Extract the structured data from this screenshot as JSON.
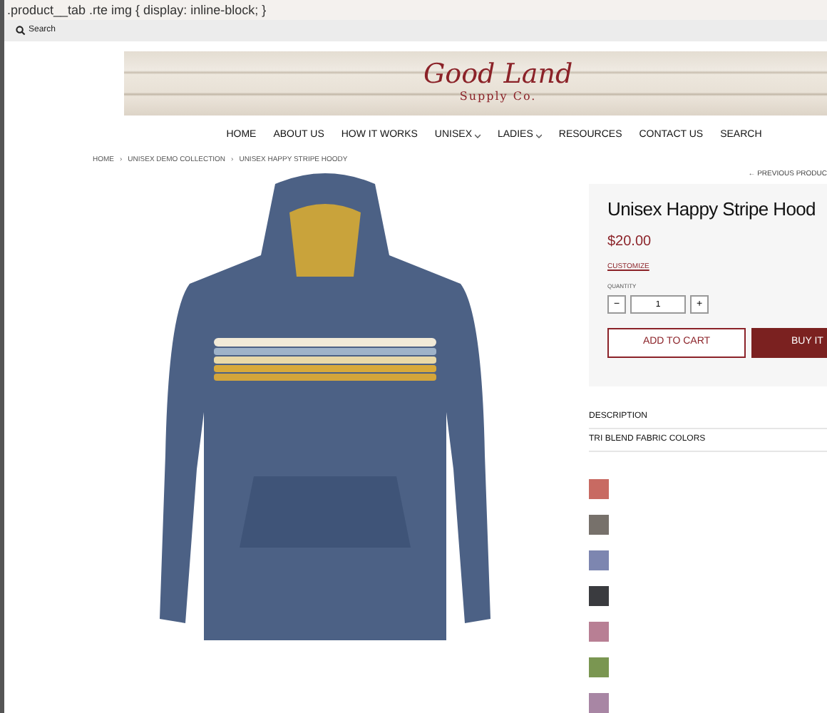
{
  "code_bar": {
    "text": ".product__tab .rte img { display: inline-block; }"
  },
  "search_bar": {
    "label": "Search"
  },
  "logo": {
    "title": "Good Land",
    "subtitle": "Supply Co."
  },
  "nav": [
    {
      "label": "HOME",
      "dropdown": false
    },
    {
      "label": "ABOUT US",
      "dropdown": false
    },
    {
      "label": "HOW IT WORKS",
      "dropdown": false
    },
    {
      "label": "UNISEX",
      "dropdown": true
    },
    {
      "label": "LADIES",
      "dropdown": true
    },
    {
      "label": "RESOURCES",
      "dropdown": false
    },
    {
      "label": "CONTACT US",
      "dropdown": false
    },
    {
      "label": "SEARCH",
      "dropdown": false
    }
  ],
  "breadcrumb": [
    "HOME",
    "UNISEX DEMO COLLECTION",
    "UNISEX HAPPY STRIPE HOODY"
  ],
  "breadcrumb_separator": "›",
  "previous_link": "← PREVIOUS PRODUC",
  "product": {
    "title": "Unisex Happy Stripe Hood",
    "price": "$20.00",
    "customize": "CUSTOMIZE",
    "quantity_label": "QUANTITY",
    "minus": "−",
    "quantity": "1",
    "plus": "+",
    "add_to_cart": "ADD TO CART",
    "buy_now": "BUY IT"
  },
  "sections": [
    "DESCRIPTION",
    "TRI BLEND FABRIC COLORS"
  ],
  "swatches": [
    {
      "color": "#c86a62"
    },
    {
      "color": "#77716b"
    },
    {
      "color": "#7d86b0"
    },
    {
      "color": "#3a3b3f"
    },
    {
      "color": "#b87f94"
    },
    {
      "color": "#7a9651"
    },
    {
      "color": "#a886a4"
    }
  ]
}
